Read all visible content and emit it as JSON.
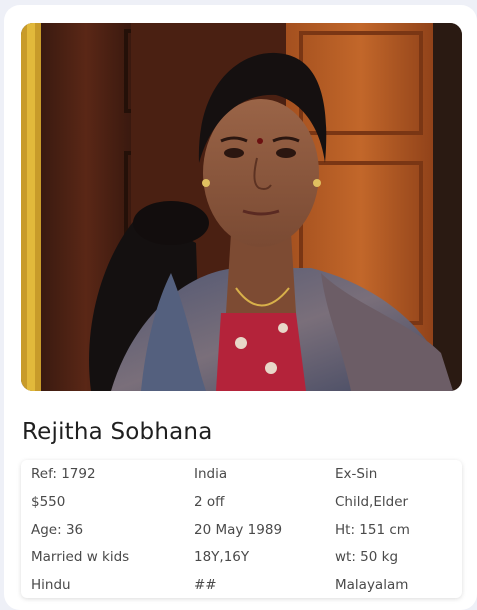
{
  "profile": {
    "name": "Rejitha Sobhana",
    "photo_alt": "Rejitha Sobhana"
  },
  "details": {
    "ref": "Ref: 1792",
    "country": "India",
    "status": "Ex-Sin",
    "salary": "$550",
    "off_days": "2 off",
    "care": "Child,Elder",
    "age": "Age: 36",
    "dob": "20 May 1989",
    "height": "Ht: 151 cm",
    "marital": "Married w kids",
    "kids_ages": "18Y,16Y",
    "weight": "wt: 50 kg",
    "religion": "Hindu",
    "extra": "##",
    "language": "Malayalam"
  },
  "colors": {
    "card_bg": "#ffffff",
    "page_bg": "#eef0f7",
    "door_wood": "#8a3f1c",
    "text": "#1f1f1f"
  }
}
